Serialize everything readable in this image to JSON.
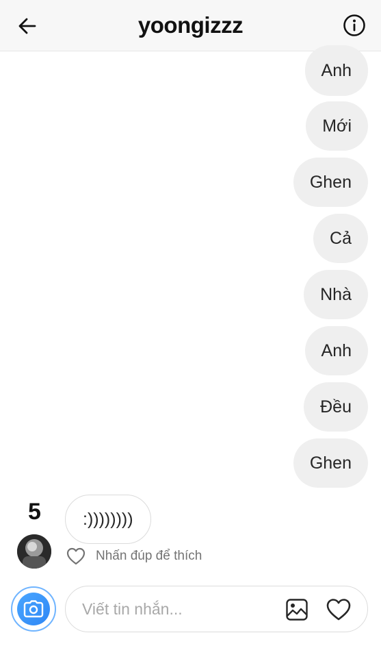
{
  "header": {
    "title": "yoongizzz",
    "back_icon": "arrow-left-icon",
    "info_icon": "info-circle-icon"
  },
  "messages_sent": [
    {
      "text": "Anh"
    },
    {
      "text": "Mới"
    },
    {
      "text": "Ghen"
    },
    {
      "text": "Cả"
    },
    {
      "text": "Nhà"
    },
    {
      "text": "Anh"
    },
    {
      "text": "Đều"
    },
    {
      "text": "Ghen"
    }
  ],
  "received": {
    "counter": "5",
    "text": ":))))))))",
    "like_hint": "Nhấn đúp để thích"
  },
  "composer": {
    "placeholder": "Viết tin nhắn...",
    "camera_icon": "camera-icon",
    "gallery_icon": "image-icon",
    "like_icon": "heart-icon"
  },
  "colors": {
    "bubble_bg": "#efefef",
    "camera_accent": "#3897f0"
  }
}
